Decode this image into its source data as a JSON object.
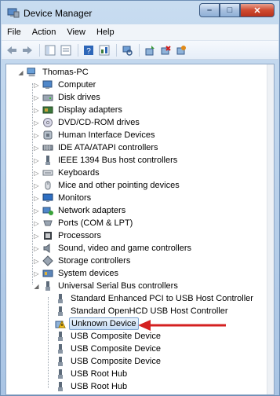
{
  "window": {
    "title": "Device Manager"
  },
  "caption": {
    "minimize": "–",
    "maximize": "□",
    "close": "✕"
  },
  "menu": [
    "File",
    "Action",
    "View",
    "Help"
  ],
  "tree": {
    "root": "Thomas-PC",
    "categories": [
      {
        "label": "Computer",
        "icon": "computer-icon"
      },
      {
        "label": "Disk drives",
        "icon": "disk-drive-icon"
      },
      {
        "label": "Display adapters",
        "icon": "display-adapter-icon"
      },
      {
        "label": "DVD/CD-ROM drives",
        "icon": "dvd-drive-icon"
      },
      {
        "label": "Human Interface Devices",
        "icon": "hid-icon"
      },
      {
        "label": "IDE ATA/ATAPI controllers",
        "icon": "ide-controller-icon"
      },
      {
        "label": "IEEE 1394 Bus host controllers",
        "icon": "ieee1394-icon"
      },
      {
        "label": "Keyboards",
        "icon": "keyboard-icon"
      },
      {
        "label": "Mice and other pointing devices",
        "icon": "mouse-icon"
      },
      {
        "label": "Monitors",
        "icon": "monitor-icon"
      },
      {
        "label": "Network adapters",
        "icon": "network-adapter-icon"
      },
      {
        "label": "Ports (COM & LPT)",
        "icon": "port-icon"
      },
      {
        "label": "Processors",
        "icon": "processor-icon"
      },
      {
        "label": "Sound, video and game controllers",
        "icon": "sound-icon"
      },
      {
        "label": "Storage controllers",
        "icon": "storage-controller-icon"
      },
      {
        "label": "System devices",
        "icon": "system-device-icon"
      },
      {
        "label": "Universal Serial Bus controllers",
        "icon": "usb-icon"
      }
    ],
    "usb_children": [
      {
        "label": "Standard Enhanced PCI to USB Host Controller",
        "icon": "usb-plug-icon"
      },
      {
        "label": "Standard OpenHCD USB Host Controller",
        "icon": "usb-plug-icon"
      },
      {
        "label": "Unknown Device",
        "icon": "warning-icon"
      },
      {
        "label": "USB Composite Device",
        "icon": "usb-plug-icon"
      },
      {
        "label": "USB Composite Device",
        "icon": "usb-plug-icon"
      },
      {
        "label": "USB Composite Device",
        "icon": "usb-plug-icon"
      },
      {
        "label": "USB Root Hub",
        "icon": "usb-plug-icon"
      },
      {
        "label": "USB Root Hub",
        "icon": "usb-plug-icon"
      }
    ]
  },
  "colors": {
    "arrow": "#d42020",
    "selection": "#c7ddf5"
  }
}
